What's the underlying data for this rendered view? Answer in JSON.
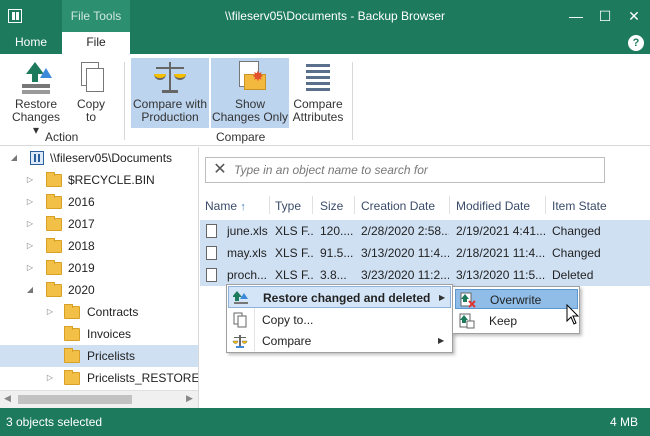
{
  "window": {
    "title": "\\\\fileserv05\\Documents - Backup Browser",
    "context_tab_title": "File Tools",
    "minimize": "—",
    "maximize": "☐",
    "close": "✕"
  },
  "ribbon": {
    "tabs": [
      {
        "label": "Home"
      },
      {
        "label": "File"
      }
    ],
    "help": "?",
    "buttons": {
      "restore": {
        "line1": "Restore",
        "line2": "Changes ▾",
        "icon": "restore-icon"
      },
      "copy": {
        "line1": "Copy",
        "line2": "to",
        "icon": "copy-icon"
      },
      "compare": {
        "line1": "Compare with",
        "line2": "Production",
        "icon": "scale-icon",
        "active": true
      },
      "showchanges": {
        "line1": "Show",
        "line2": "Changes Only",
        "icon": "show-changes-icon",
        "active": true
      },
      "attrs": {
        "line1": "Compare",
        "line2": "Attributes",
        "icon": "attributes-icon"
      }
    },
    "groups": {
      "action": "Action",
      "compare": "Compare"
    }
  },
  "tree": {
    "root": "\\\\fileserv05\\Documents",
    "items": [
      {
        "label": "$RECYCLE.BIN",
        "level": 1,
        "expander": "▷"
      },
      {
        "label": "2016",
        "level": 1,
        "expander": "▷"
      },
      {
        "label": "2017",
        "level": 1,
        "expander": "▷"
      },
      {
        "label": "2018",
        "level": 1,
        "expander": "▷"
      },
      {
        "label": "2019",
        "level": 1,
        "expander": "▷"
      },
      {
        "label": "2020",
        "level": 1,
        "expander": "◢"
      },
      {
        "label": "Contracts",
        "level": 2,
        "expander": "▷"
      },
      {
        "label": "Invoices",
        "level": 2,
        "expander": ""
      },
      {
        "label": "Pricelists",
        "level": 2,
        "expander": "",
        "selected": true
      },
      {
        "label": "Pricelists_RESTORED_",
        "level": 2,
        "expander": "▷"
      }
    ]
  },
  "search": {
    "placeholder": "Type in an object name to search for"
  },
  "table": {
    "columns": [
      "Name",
      "Type",
      "Size",
      "Creation Date",
      "Modified Date",
      "Item State"
    ],
    "sort_indicator": "↑",
    "rows": [
      {
        "name": "june.xls",
        "type": "XLS F...",
        "size": "120....",
        "created": "2/28/2020 2:58...",
        "modified": "2/19/2021 4:41...",
        "state": "Changed"
      },
      {
        "name": "may.xls",
        "type": "XLS F...",
        "size": "91.5...",
        "created": "3/13/2020 11:4...",
        "modified": "2/18/2021 11:4...",
        "state": "Changed"
      },
      {
        "name": "proch...",
        "type": "XLS F...",
        "size": "3.8...",
        "created": "3/23/2020 11:2...",
        "modified": "3/13/2020 11:5...",
        "state": "Deleted"
      }
    ]
  },
  "context_menu": {
    "items": [
      {
        "label": "Restore changed and deleted",
        "has_submenu": true,
        "highlighted": true
      },
      {
        "label": "Copy to...",
        "has_submenu": false
      },
      {
        "label": "Compare",
        "has_submenu": true
      }
    ],
    "submenu": [
      {
        "label": "Overwrite",
        "highlighted": true
      },
      {
        "label": "Keep"
      }
    ]
  },
  "status": {
    "left": "3 objects selected",
    "right": "4 MB"
  },
  "colors": {
    "brand": "#1d7a5c",
    "selection": "#cfe0f3",
    "active_button": "#bcd4ee"
  }
}
